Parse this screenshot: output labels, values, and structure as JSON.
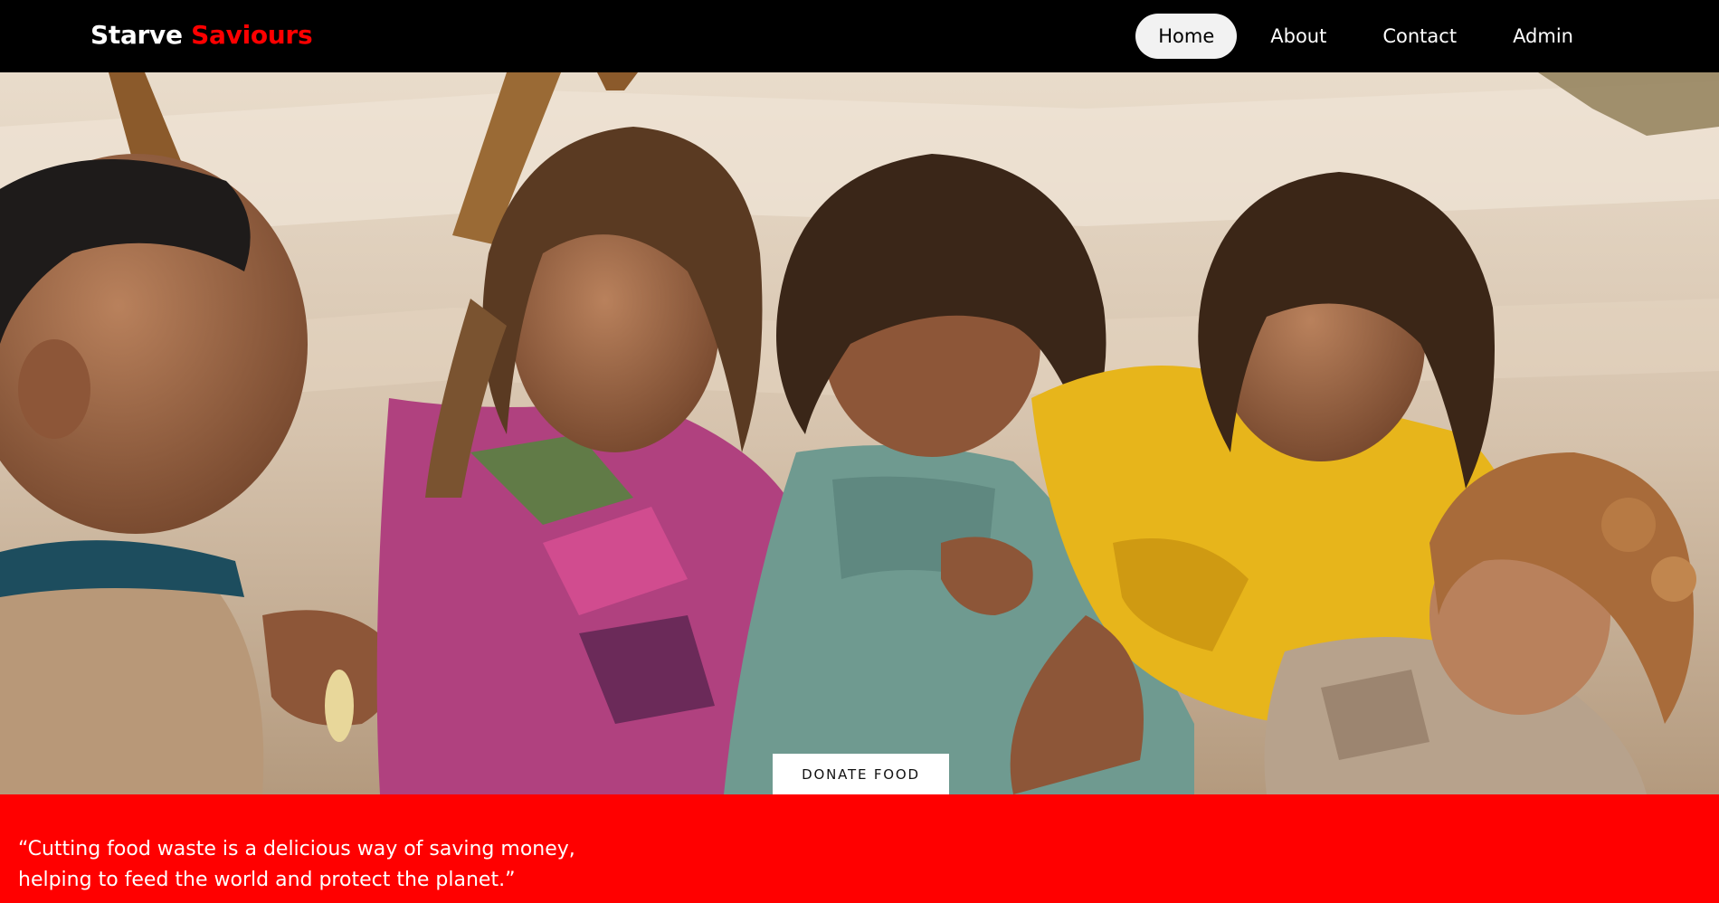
{
  "nav": {
    "brand_primary": "Starve",
    "brand_accent": "Saviours",
    "links": [
      {
        "label": "Home",
        "active": true
      },
      {
        "label": "About",
        "active": false
      },
      {
        "label": "Contact",
        "active": false
      },
      {
        "label": "Admin",
        "active": false
      }
    ]
  },
  "hero": {
    "image_icon": "hero-photo-children-icon",
    "cta_label": "DONATE FOOD"
  },
  "quote": {
    "line1": "“Cutting food waste is a delicious way of saving money,",
    "line2": "helping to feed the world and protect the planet.”"
  },
  "colors": {
    "accent": "#ff0000",
    "navbar_bg": "#000000",
    "active_pill_bg": "#f2f2f2",
    "cta_bg": "#ffffff"
  }
}
